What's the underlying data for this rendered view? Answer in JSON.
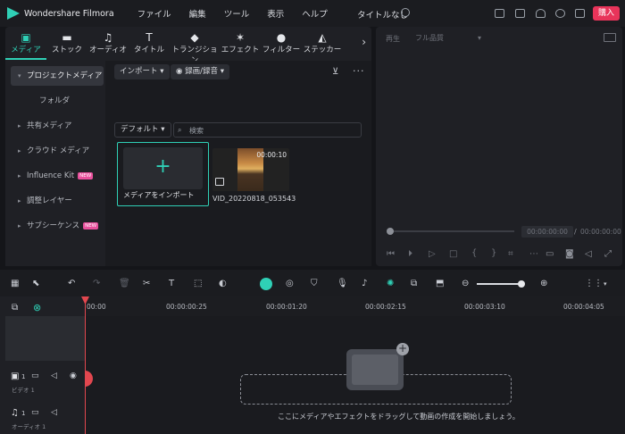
{
  "titlebar": {
    "app_name": "Wondershare Filmora",
    "menus": [
      "ファイル",
      "編集",
      "ツール",
      "表示",
      "ヘルプ"
    ],
    "doc_title": "タイトルなし",
    "buy_label": "購入",
    "accent": "#2fd0b6",
    "buy_color": "#e8345a"
  },
  "tabs": [
    {
      "label": "メディア",
      "icon": "media-icon"
    },
    {
      "label": "ストック",
      "icon": "stock-icon"
    },
    {
      "label": "オーディオ",
      "icon": "music-note-icon"
    },
    {
      "label": "タイトル",
      "icon": "text-t-icon"
    },
    {
      "label": "トランジション",
      "icon": "transition-icon"
    },
    {
      "label": "エフェクト",
      "icon": "sparkle-icon"
    },
    {
      "label": "フィルター",
      "icon": "filter-icon"
    },
    {
      "label": "ステッカー",
      "icon": "sticker-icon"
    }
  ],
  "sidebar": {
    "items": [
      {
        "label": "プロジェクトメディア",
        "active": true
      },
      {
        "label": "フォルダ"
      },
      {
        "label": "共有メディア"
      },
      {
        "label": "クラウド メディア"
      },
      {
        "label": "Influence Kit",
        "badge": "NEW"
      },
      {
        "label": "調整レイヤー"
      },
      {
        "label": "サブシーケンス",
        "badge": "NEW"
      }
    ]
  },
  "content": {
    "import_label": "インポート",
    "record_label": "録画/録音",
    "sort_label": "デフォルト",
    "search_placeholder": "検索",
    "import_card_label": "メディアをインポート",
    "clip": {
      "duration": "00:00:10",
      "name": "VID_20220818_053543"
    }
  },
  "player": {
    "label": "再生",
    "quality": "フル品質",
    "current_time": "00:00:00:00",
    "separator": "/",
    "total_time": "00:00:00:00"
  },
  "timeline": {
    "ticks": [
      "00:00",
      "00:00:00:25",
      "00:00:01:20",
      "00:00:02:15",
      "00:00:03:10",
      "00:00:04:05"
    ],
    "video_track": "ビデオ 1",
    "audio_track": "オーディオ 1",
    "video_index": "1",
    "audio_index": "1",
    "drop_hint": "ここにメディアやエフェクトをドラッグして動画の作成を開始しましょう。"
  }
}
